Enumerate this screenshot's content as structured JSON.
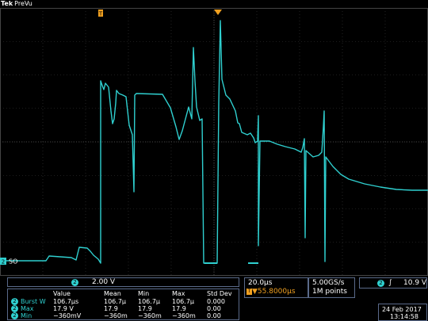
{
  "header": {
    "brand": "Tek",
    "mode": "PreVu"
  },
  "screen": {
    "trigger_marker": "T",
    "ch_label": "2",
    "ch_sublabel": "SO",
    "colors": {
      "trace": "#2fd0d0",
      "grid": "#3a3a3a",
      "marker": "#f0a020",
      "bg": "#000000"
    }
  },
  "channel": {
    "badge": "2",
    "scale": "2.00 V"
  },
  "measurements": {
    "headers": [
      "Value",
      "Mean",
      "Min",
      "Max",
      "Std Dev"
    ],
    "rows": [
      {
        "ch": "2",
        "name": "Burst W",
        "values": [
          "106.7µs",
          "106.7µ",
          "106.7µ",
          "106.7µ",
          "0.000"
        ]
      },
      {
        "ch": "2",
        "name": "Max",
        "values": [
          "17.9 V",
          "17.9",
          "17.9",
          "17.9",
          "0.00"
        ]
      },
      {
        "ch": "2",
        "name": "Min",
        "values": [
          "−360mV",
          "−360m",
          "−360m",
          "−360m",
          "0.00"
        ]
      }
    ]
  },
  "horizontal": {
    "scale": "20.0µs",
    "position": "▼55.8000µs"
  },
  "acquisition": {
    "rate": "5.00GS/s",
    "points": "1M points"
  },
  "trigger": {
    "ch": "2",
    "slope": "∫",
    "level": "10.9 V"
  },
  "datetime": {
    "date": "24 Feb  2017",
    "time": "13:14:58"
  }
}
